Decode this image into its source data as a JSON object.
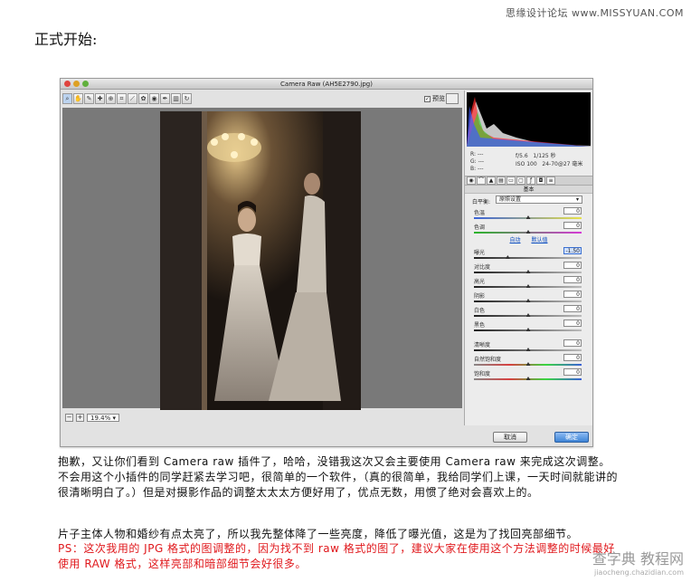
{
  "watermark_top": "思缘设计论坛 www.MISSYUAN.COM",
  "heading": "正式开始:",
  "window": {
    "title": "Camera Raw (AH5E2790.jpg)",
    "preview_label": "预览",
    "zoom_value": "19.4%",
    "cancel_label": "取消",
    "ok_label": "确定"
  },
  "toolbar_icons": [
    "zoom-icon",
    "hand-icon",
    "white-balance-icon",
    "color-sampler-icon",
    "target-adjust-icon",
    "crop-icon",
    "straighten-icon",
    "spot-removal-icon",
    "red-eye-icon",
    "adjust-brush-icon",
    "graduated-filter-icon",
    "rotate-icon"
  ],
  "colors": {
    "accent": "#3e84d6",
    "red_text": "#e0181c"
  },
  "panel": {
    "rgb": {
      "r": "R: ---",
      "g": "G: ---",
      "b": "B: ---"
    },
    "exif": {
      "aperture": "f/5.6",
      "shutter": "1/125 秒",
      "iso": "ISO 100",
      "lens": "24-70@27 毫米"
    },
    "section_title": "基本",
    "white_balance_label": "白平衡:",
    "white_balance_value": "原照设置",
    "auto_label": "自动",
    "default_label": "默认值",
    "rows_top": [
      {
        "label": "色温",
        "value": "0",
        "pos": 0.5
      },
      {
        "label": "色调",
        "value": "0",
        "pos": 0.5
      }
    ],
    "rows_tone": [
      {
        "label": "曝光",
        "value": "-1.50",
        "pos": 0.31
      },
      {
        "label": "对比度",
        "value": "0",
        "pos": 0.5
      },
      {
        "label": "高光",
        "value": "0",
        "pos": 0.5
      },
      {
        "label": "阴影",
        "value": "0",
        "pos": 0.5
      },
      {
        "label": "白色",
        "value": "0",
        "pos": 0.5
      },
      {
        "label": "黑色",
        "value": "0",
        "pos": 0.5
      }
    ],
    "rows_presence": [
      {
        "label": "清晰度",
        "value": "0",
        "pos": 0.5
      },
      {
        "label": "自然饱和度",
        "value": "0",
        "pos": 0.5
      },
      {
        "label": "饱和度",
        "value": "0",
        "pos": 0.5
      }
    ]
  },
  "paragraphs": {
    "p1": "抱歉，又让你们看到 Camera raw 插件了，哈哈，没错我这次又会主要使用 Camera raw 来完成这次调整。不会用这个小插件的同学赶紧去学习吧，很简单的一个软件，（真的很简单，我给同学们上课，一天时间就能讲的很清晰明白了。）但是对摄影作品的调整太太太方便好用了，优点无数，用惯了绝对会喜欢上的。",
    "p2": "片子主体人物和婚纱有点太亮了，所以我先整体降了一些亮度，降低了曝光值，这是为了找回亮部细节。",
    "p3": "PS：这次我用的 JPG 格式的图调整的，因为找不到 raw 格式的图了，建议大家在使用这个方法调整的时候最好使用 RAW 格式，这样亮部和暗部细节会好很多。"
  },
  "watermark_bottom": {
    "main": "查字典 教程网",
    "sub": "jiaocheng.chazidian.com"
  }
}
